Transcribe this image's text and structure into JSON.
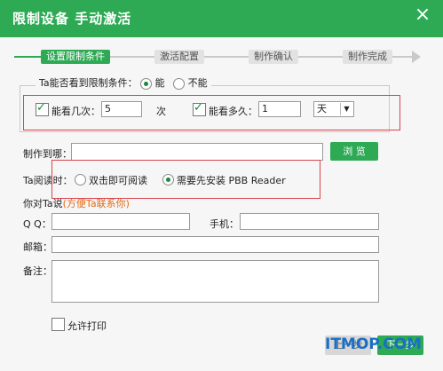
{
  "window": {
    "title": "限制设备 手动激活",
    "close_glyph": "×"
  },
  "steps": [
    {
      "label": "设置限制条件",
      "active": true
    },
    {
      "label": "激活配置",
      "active": false
    },
    {
      "label": "制作确认",
      "active": false
    },
    {
      "label": "制作完成",
      "active": false
    }
  ],
  "restrict": {
    "question": "Ta能否看到限制条件：",
    "option_yes": "能",
    "option_no": "不能",
    "times_label": "能看几次：",
    "times_value": "5",
    "times_unit": "次",
    "duration_label": "能看多久：",
    "duration_value": "1",
    "duration_unit_selected": "天"
  },
  "output": {
    "label": "制作到哪：",
    "path_value": "",
    "browse_label": "浏 览"
  },
  "read_mode": {
    "label": "Ta阅读时：",
    "option_direct": "双击即可阅读",
    "option_reader": "需要先安装 PBB Reader"
  },
  "contact": {
    "heading": "你对Ta说",
    "heading_note": "(方便Ta联系你)",
    "qq_label": "Q  Q：",
    "qq_value": "",
    "phone_label": "手机：",
    "phone_value": "",
    "email_label": "邮箱：",
    "email_value": "",
    "note_label": "备注：",
    "note_value": ""
  },
  "allow_print_label": "允许打印",
  "footer": {
    "prev_label": "上一步",
    "next_label": "下一步"
  },
  "watermark": "ITMOP.COM",
  "colors": {
    "brand_green": "#2eaa55",
    "highlight_red": "#d9444f"
  }
}
